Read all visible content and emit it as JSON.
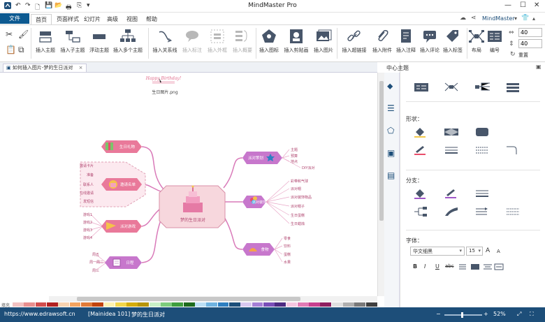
{
  "titlebar": {
    "app_title": "MindMaster Pro",
    "minimize": "—",
    "maximize": "☐",
    "close": "✕"
  },
  "menu": {
    "file": "文件",
    "tabs": [
      "首页",
      "页面样式",
      "幻灯片",
      "高级",
      "视图",
      "帮助"
    ],
    "account": "MindMaster",
    "account_caret": "▾"
  },
  "ribbon": {
    "clipboard": [
      "",
      ""
    ],
    "insert_topic": "插入主题",
    "insert_subtopic": "插入子主题",
    "floating_topic": "浮动主题",
    "insert_multiple": "插入多个主题",
    "insert_relation": "插入关系线",
    "insert_callout": "插入标注",
    "insert_boundary": "插入外框",
    "insert_summary": "插入概要",
    "insert_icon": "插入图标",
    "insert_clipart": "插入剪贴画",
    "insert_image": "插入图片",
    "insert_hyperlink": "插入超链接",
    "insert_attachment": "插入附件",
    "insert_note": "插入注释",
    "insert_comment": "插入评论",
    "insert_tag": "插入标签",
    "layout": "布局",
    "numbering": "编号",
    "spacing_h": "40",
    "spacing_v": "40",
    "reset": "重置"
  },
  "doctab": {
    "label": "如何插入图片-梦的生日派对",
    "close": "×"
  },
  "canvas": {
    "floating_image_caption": "生日图片.png",
    "happy_text": "Happy Birthday!",
    "central_label": "梦的生日派对",
    "left_nodes": [
      {
        "label": "生日礼物"
      },
      {
        "label": "邀请名单"
      },
      {
        "label": "派对游戏"
      },
      {
        "label": "日程"
      }
    ],
    "right_nodes": [
      {
        "label": "派对策划"
      },
      {
        "label": "派对装饰"
      },
      {
        "label": "食物"
      }
    ],
    "left_leaves": [
      [
        "邀请卡片",
        "准备",
        "联系人",
        "在线邀请",
        "发短信"
      ],
      [
        "游戏1",
        "游戏2",
        "游戏3",
        "游戏4"
      ],
      [
        "周五",
        "周一",
        "周二",
        "周三"
      ]
    ],
    "right_leaves": [
      [
        "主题",
        "预算",
        "地点",
        "DIY派对"
      ],
      [
        "彩带和气球",
        "派对帽",
        "派对装饰物品",
        "派对帽子",
        "生日蛋糕",
        "生日蜡烛"
      ],
      [
        "零食",
        "饮料",
        "蛋糕",
        "水果"
      ]
    ]
  },
  "panel": {
    "header": "中心主题",
    "shape_label": "形状：",
    "branch_label": "分支：",
    "font_label": "字体：",
    "font_name": "华文细黑",
    "font_size": "15",
    "font_inc": "A",
    "font_dec": "A",
    "bold": "B",
    "italic": "I",
    "underline": "U",
    "strike": "abc"
  },
  "status": {
    "url": "https://www.edrawsoft.cn",
    "file": "[Mainidea 101]",
    "doc": "梦的生日派对",
    "zoom": "52%",
    "zoom_minus": "−",
    "zoom_plus": "+",
    "fit": "⤢",
    "fullscreen": "⛶"
  },
  "colors": {
    "accent": "#1d4e79",
    "central_fill": "#f7d7dd",
    "central_border": "#e2a0b0",
    "pink_node": "#e9799a",
    "purple_node": "#c777cc",
    "branch_line": "#d97ab9"
  },
  "palette": [
    "#f3c2c2",
    "#e88f8f",
    "#d14d4d",
    "#b22222",
    "#f7d2b0",
    "#f4a460",
    "#e07b39",
    "#c1440e",
    "#fff3b0",
    "#f2d64b",
    "#d4ac0d",
    "#b7950b",
    "#c7f0c7",
    "#7dcc7d",
    "#3f9e3f",
    "#1d6b1d",
    "#bde0f5",
    "#6fb3e0",
    "#2d7fc1",
    "#1b4f7a",
    "#d9c8f0",
    "#a57fd6",
    "#7a4fb8",
    "#4d2b82",
    "#f5c6e1",
    "#e07bb5",
    "#c7408f",
    "#8f1f60",
    "#e0e0e0",
    "#b0b0b0",
    "#7a7a7a",
    "#404040"
  ]
}
